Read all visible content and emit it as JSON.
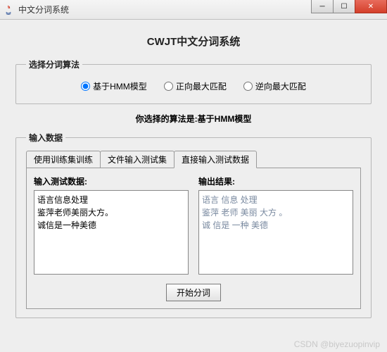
{
  "window": {
    "title": "中文分词系统",
    "min": "─",
    "max": "☐",
    "close": "✕"
  },
  "header": {
    "title": "CWJT中文分词系统"
  },
  "algorithm": {
    "legend": "选择分词算法",
    "options": [
      {
        "label": "基于HMM模型",
        "selected": true
      },
      {
        "label": "正向最大匹配",
        "selected": false
      },
      {
        "label": "逆向最大匹配",
        "selected": false
      }
    ]
  },
  "selection_text": {
    "prefix": "你选择的算法是:",
    "value": "基于HMM模型"
  },
  "input_data": {
    "legend": "输入数据",
    "tabs": [
      {
        "label": "使用训练集训练",
        "active": false
      },
      {
        "label": "文件输入测试集",
        "active": false
      },
      {
        "label": "直接输入测试数据",
        "active": true
      }
    ],
    "input_label": "输入测试数据:",
    "input_value": "语言信息处理\n鉴萍老师美丽大方。\n诚信是一种美德",
    "output_label": "输出结果:",
    "output_value": "语言 信息 处理\n鉴萍 老师 美丽 大方 。\n诚 信是 一种 美德",
    "button": "开始分词"
  },
  "watermark": "CSDN @biyezuopinvip"
}
